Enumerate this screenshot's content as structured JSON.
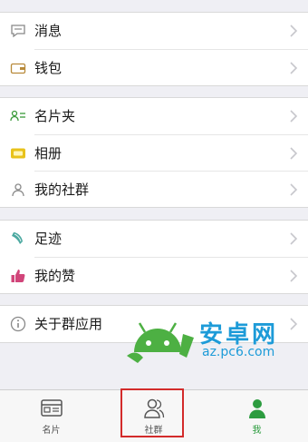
{
  "groups": [
    {
      "items": [
        {
          "label": "消息",
          "icon": "message-icon"
        },
        {
          "label": "钱包",
          "icon": "wallet-icon"
        }
      ]
    },
    {
      "items": [
        {
          "label": "名片夹",
          "icon": "business-card-icon"
        },
        {
          "label": "相册",
          "icon": "photo-album-icon"
        },
        {
          "label": "我的社群",
          "icon": "community-icon"
        }
      ]
    },
    {
      "items": [
        {
          "label": "足迹",
          "icon": "footprint-icon"
        },
        {
          "label": "我的赞",
          "icon": "thumbs-up-icon"
        }
      ]
    },
    {
      "items": [
        {
          "label": "关于群应用",
          "icon": "info-icon"
        }
      ]
    }
  ],
  "tabs": [
    {
      "label": "名片",
      "icon": "id-card-icon"
    },
    {
      "label": "社群",
      "icon": "people-icon"
    },
    {
      "label": "我",
      "icon": "person-icon"
    }
  ],
  "watermark": {
    "brand": "安卓网",
    "url": "az.pc6.com"
  },
  "colors": {
    "accent": "#2c9c3f",
    "highlight": "#d32b2b",
    "watermark": "#1d9bd8"
  }
}
